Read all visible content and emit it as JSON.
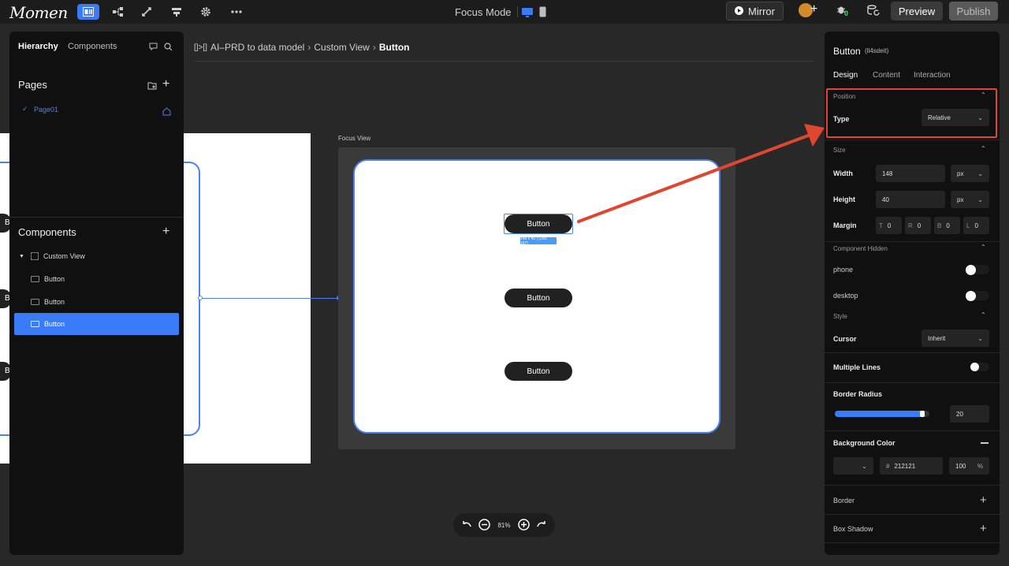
{
  "app": {
    "logo": "Momen",
    "focus_mode": "Focus Mode",
    "mirror": "Mirror",
    "preview": "Preview",
    "publish": "Publish",
    "badge": "0"
  },
  "breadcrumb": {
    "prefix": "[]>[]",
    "items": [
      "AI–PRD to data model",
      "Custom View",
      "Button"
    ]
  },
  "left": {
    "tabs": [
      "Hierarchy",
      "Components"
    ],
    "pages_title": "Pages",
    "pages": [
      "Page01"
    ],
    "components_title": "Components",
    "tree": [
      {
        "label": "Custom View",
        "selected": false
      },
      {
        "label": "Button",
        "selected": false
      },
      {
        "label": "Button",
        "selected": false
      },
      {
        "label": "Button",
        "selected": true
      }
    ]
  },
  "canvas": {
    "focus_label": "Focus View",
    "buttons": [
      "Button",
      "Button",
      "Button"
    ],
    "dim_tag": "148 x 40 | (250, 167)",
    "zoom": "81%"
  },
  "right": {
    "title": "Button",
    "id": "(ll4sdeit)",
    "tabs": [
      "Design",
      "Content",
      "Interaction"
    ],
    "position": {
      "header": "Position",
      "type_label": "Type",
      "type_value": "Relative"
    },
    "size": {
      "header": "Size",
      "width_label": "Width",
      "width": "148",
      "height_label": "Height",
      "height": "40",
      "unit": "px",
      "margin_label": "Margin",
      "margin": [
        {
          "k": "T",
          "v": "0"
        },
        {
          "k": "R",
          "v": "0"
        },
        {
          "k": "B",
          "v": "0"
        },
        {
          "k": "L",
          "v": "0"
        }
      ]
    },
    "hidden": {
      "header": "Component Hidden",
      "phone": "phone",
      "desktop": "desktop"
    },
    "style": {
      "header": "Style",
      "cursor_label": "Cursor",
      "cursor_value": "Inherit"
    },
    "multiple_lines": "Multiple Lines",
    "border_radius": {
      "label": "Border Radius",
      "value": "20",
      "fraction": 0.95
    },
    "bg": {
      "label": "Background Color",
      "hash": "#",
      "hex": "212121",
      "opacity": "100",
      "pct": "%"
    },
    "border": "Border",
    "shadow": "Box Shadow"
  },
  "colors": {
    "accent": "#3a7bf7",
    "annotation": "#e04530",
    "button": "#212121"
  }
}
